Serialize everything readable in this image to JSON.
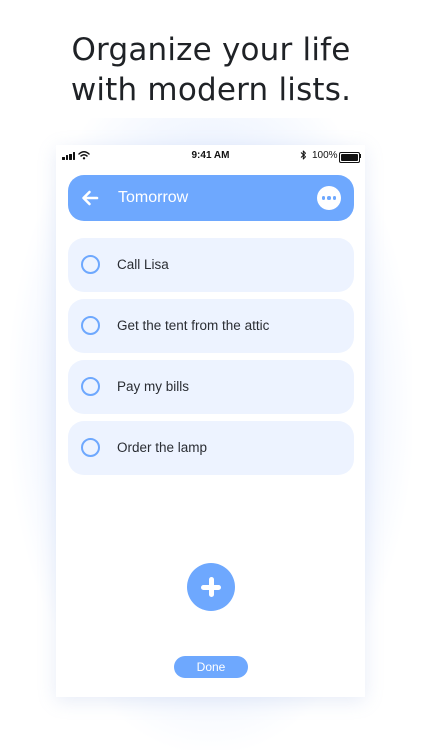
{
  "headline": {
    "line1": "Organize your life",
    "line2": "with modern lists."
  },
  "status_bar": {
    "time": "9:41 AM",
    "battery_text": "100%",
    "icons": [
      "signal-icon",
      "wifi-icon",
      "bluetooth-icon",
      "battery-icon"
    ]
  },
  "header": {
    "title": "Tomorrow",
    "back_icon": "arrow-left-icon",
    "more_icon": "more-icon"
  },
  "tasks": [
    {
      "label": "Call Lisa"
    },
    {
      "label": "Get the tent from the attic"
    },
    {
      "label": "Pay my bills"
    },
    {
      "label": "Order the lamp"
    }
  ],
  "add_icon": "plus-icon",
  "footer": {
    "done_label": "Done"
  },
  "colors": {
    "accent": "#6ea8fe",
    "task_background": "#edf3ff",
    "headline_text": "#1f2226"
  }
}
